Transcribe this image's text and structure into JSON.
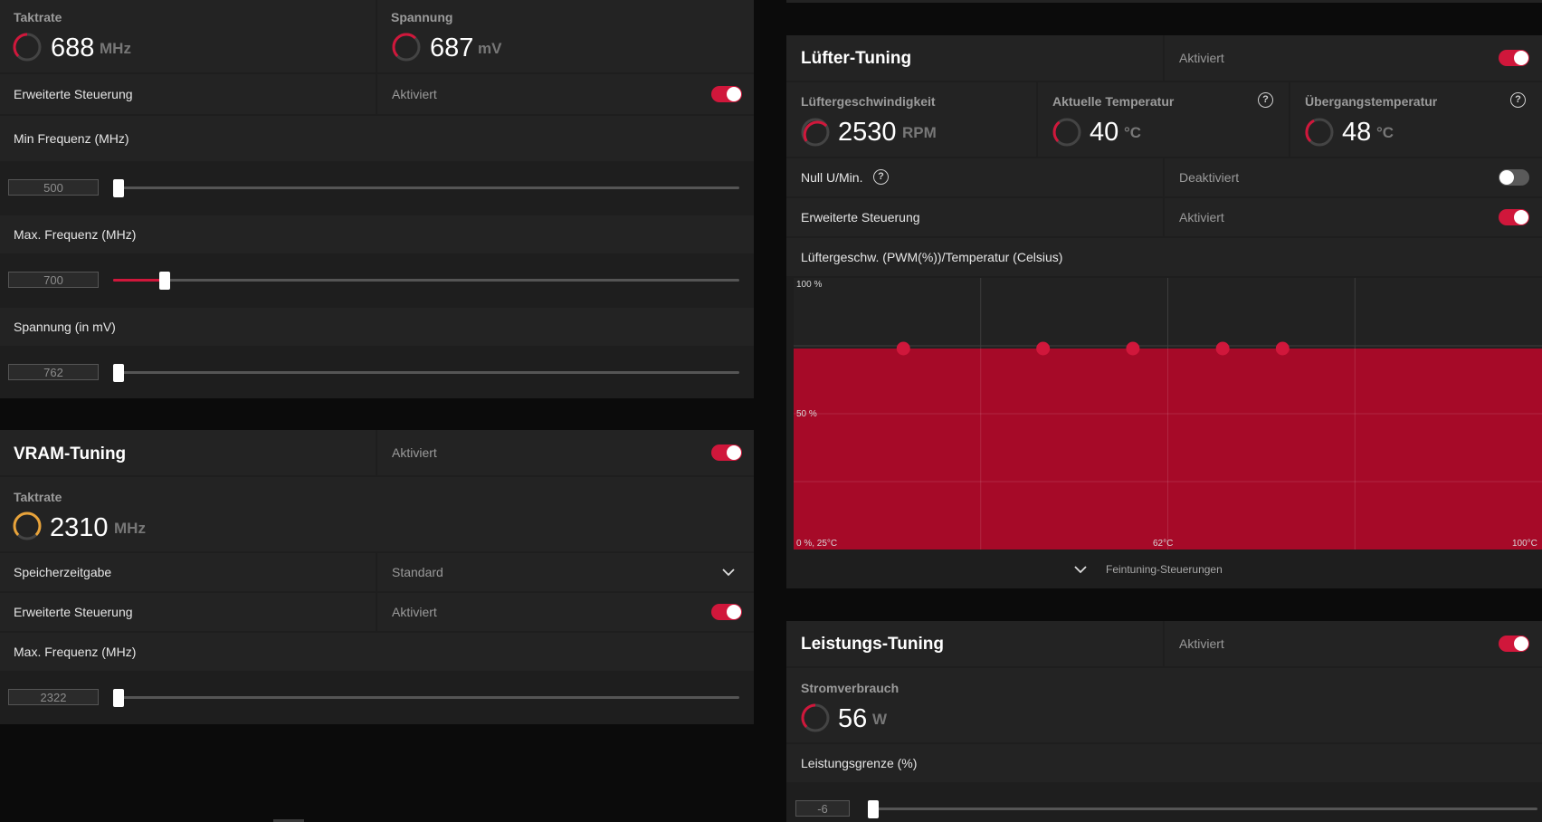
{
  "gpu": {
    "clock": {
      "title": "Taktrate",
      "value": "688",
      "unit": "MHz"
    },
    "voltage": {
      "title": "Spannung",
      "value": "687",
      "unit": "mV"
    },
    "advanced": {
      "label": "Erweiterte Steuerung",
      "state": "Aktiviert",
      "enabled": true
    },
    "min_freq": {
      "label": "Min Frequenz (MHz)",
      "value": "500"
    },
    "max_freq": {
      "label": "Max. Frequenz (MHz)",
      "value": "700"
    },
    "voltage_mv": {
      "label": "Spannung (in mV)",
      "value": "762"
    }
  },
  "vram": {
    "title": "VRAM-Tuning",
    "state": "Aktiviert",
    "enabled": true,
    "clock": {
      "title": "Taktrate",
      "value": "2310",
      "unit": "MHz"
    },
    "timing": {
      "label": "Speicherzeitgabe",
      "value": "Standard"
    },
    "advanced": {
      "label": "Erweiterte Steuerung",
      "state": "Aktiviert",
      "enabled": true
    },
    "max_freq": {
      "label": "Max. Frequenz (MHz)",
      "value": "2322"
    }
  },
  "fan": {
    "title": "Lüfter-Tuning",
    "state": "Aktiviert",
    "enabled": true,
    "speed": {
      "title": "Lüftergeschwindigkeit",
      "value": "2530",
      "unit": "RPM"
    },
    "current_temp": {
      "title": "Aktuelle Temperatur",
      "value": "40",
      "unit": "°C"
    },
    "junction_temp": {
      "title": "Übergangstemperatur",
      "value": "48",
      "unit": "°C"
    },
    "zero_rpm": {
      "label": "Null U/Min.",
      "state": "Deaktiviert",
      "enabled": false
    },
    "advanced": {
      "label": "Erweiterte Steuerung",
      "state": "Aktiviert",
      "enabled": true
    },
    "curve_label": "Lüftergeschw. (PWM(%))/Temperatur (Celsius)",
    "fine_tune_label": "Feintuning-Steuerungen"
  },
  "power": {
    "title": "Leistungs-Tuning",
    "state": "Aktiviert",
    "enabled": true,
    "consumption": {
      "title": "Stromverbrauch",
      "value": "56",
      "unit": "W"
    },
    "limit": {
      "label": "Leistungsgrenze (%)",
      "value": "-6"
    }
  },
  "colors": {
    "accent": "#d0173b",
    "vram_gauge": "#e8a33a",
    "curve_fill": "#a60a28"
  },
  "chart_data": {
    "type": "area",
    "y_tick_labels": [
      "100 %",
      "50 %"
    ],
    "x_tick_labels": [
      "0 %, 25°C",
      "62°C",
      "100°C"
    ],
    "xlim": [
      25,
      100
    ],
    "ylim": [
      0,
      100
    ],
    "points": [
      {
        "x": 36,
        "y": 74
      },
      {
        "x": 50,
        "y": 74
      },
      {
        "x": 59,
        "y": 74
      },
      {
        "x": 68,
        "y": 74
      },
      {
        "x": 74,
        "y": 74
      }
    ]
  }
}
